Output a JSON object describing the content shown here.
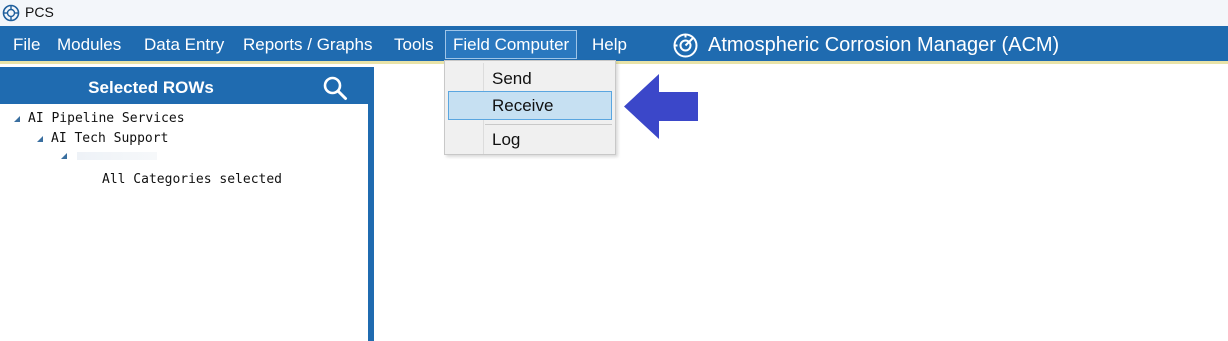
{
  "app": {
    "title": "PCS"
  },
  "menu": {
    "items": [
      "File",
      "Modules",
      "Data Entry",
      "Reports / Graphs",
      "Tools",
      "Field Computer",
      "Help"
    ],
    "active_item": "Field Computer"
  },
  "brand": {
    "title": "Atmospheric Corrosion Manager (ACM)"
  },
  "sidebar": {
    "title": "Selected ROWs",
    "tree": [
      {
        "label": "AI Pipeline Services",
        "expanded": true
      },
      {
        "label": "AI Tech Support",
        "expanded": true
      },
      {
        "label": "",
        "expanded": true
      },
      {
        "label": "All Categories selected"
      }
    ]
  },
  "dropdown": {
    "items": [
      "Send",
      "Receive",
      "Log"
    ],
    "highlighted": "Receive"
  },
  "colors": {
    "menubar": "#1f6bb0",
    "accent_line": "#e8e3a8",
    "highlight": "#c6e0f2",
    "arrow": "#3b47c9"
  }
}
